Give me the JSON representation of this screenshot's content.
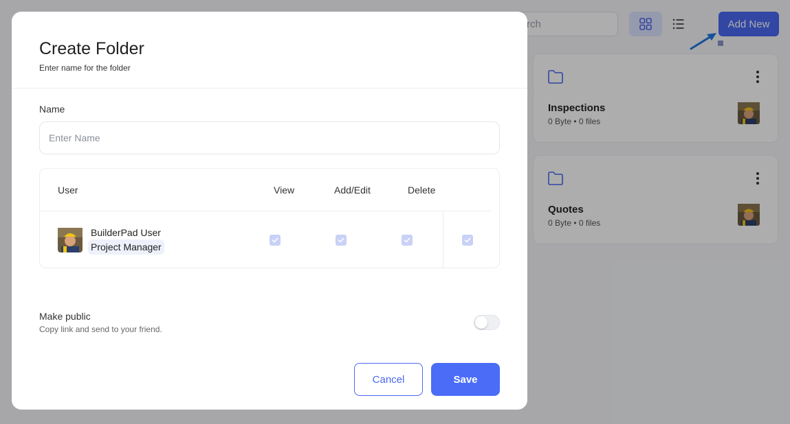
{
  "background": {
    "search": {
      "value": "rch"
    },
    "add_new_label": "Add New",
    "folders": [
      {
        "name": "Inspections",
        "size": "0 Byte",
        "files": "0 files"
      },
      {
        "name": "Quotes",
        "size": "0 Byte",
        "files": "0 files"
      }
    ]
  },
  "modal": {
    "title": "Create Folder",
    "subtitle": "Enter name for the folder",
    "name_label": "Name",
    "name_placeholder": "Enter Name",
    "table": {
      "headers": {
        "user": "User",
        "view": "View",
        "add_edit": "Add/Edit",
        "delete": "Delete"
      },
      "rows": [
        {
          "user_name": "BuilderPad User",
          "role": "Project Manager",
          "view": true,
          "add_edit": true,
          "delete": true,
          "extra": true
        }
      ]
    },
    "public": {
      "label": "Make public",
      "description": "Copy link and send to your friend.",
      "enabled": false
    },
    "cancel_label": "Cancel",
    "save_label": "Save"
  },
  "colors": {
    "primary": "#4a67f0",
    "checkbox_checked": "#c9d1f6",
    "overlay": "rgba(0,0,0,0.32)"
  }
}
